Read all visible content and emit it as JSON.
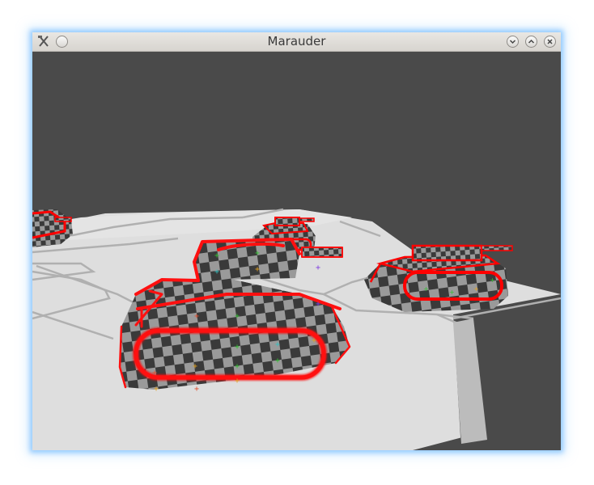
{
  "window": {
    "title": "Marauder",
    "icons": {
      "app": "crossed-tools-icon",
      "menu": "circle-menu-icon",
      "minimize": "chevron-down-icon",
      "maximize": "chevron-up-icon",
      "close": "close-icon"
    }
  },
  "scene": {
    "background_color": "#4a4a4a",
    "ground_color": "#dedede",
    "tile_border_color": "#b0b0b0",
    "tank_outline_color": "#ff0000",
    "checker_dark": "#3a3a3a",
    "checker_light": "#9a9a9a"
  }
}
